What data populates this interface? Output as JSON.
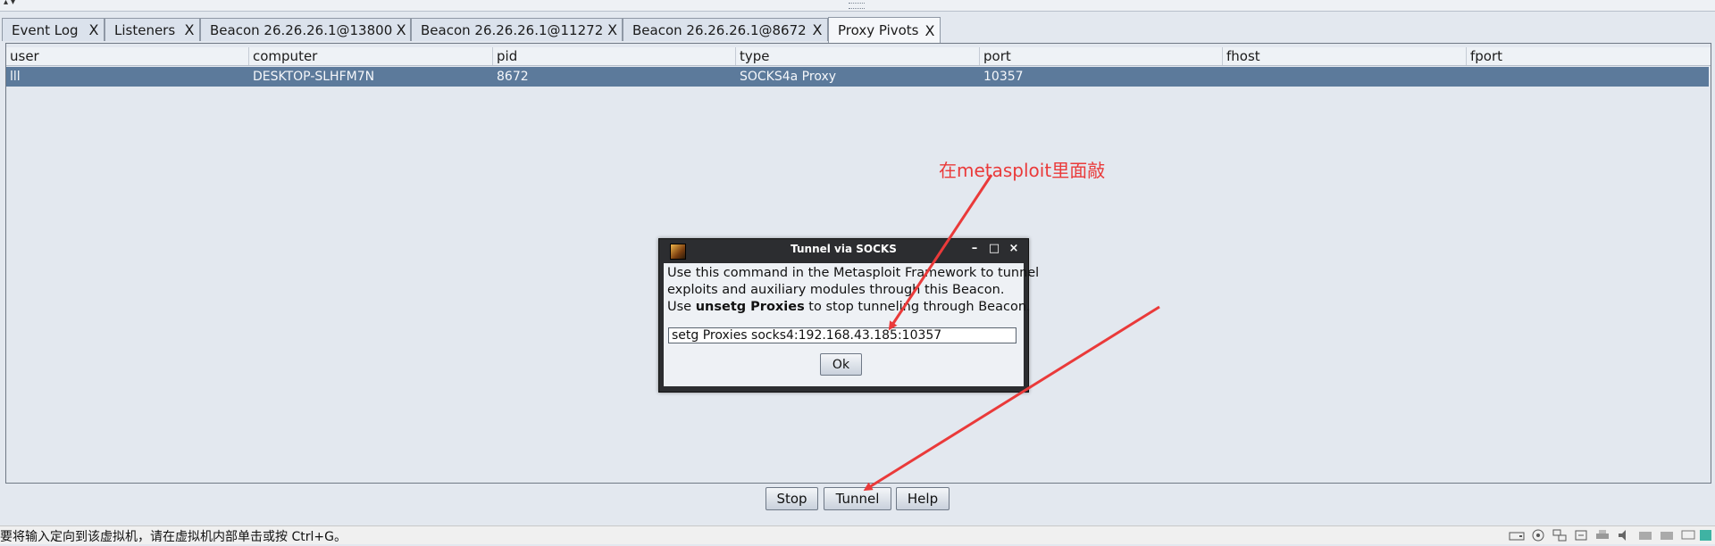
{
  "tabs": [
    {
      "label": "Event Log",
      "close": "X"
    },
    {
      "label": "Listeners",
      "close": "X"
    },
    {
      "label": "Beacon 26.26.26.1@13800",
      "close": "X"
    },
    {
      "label": "Beacon 26.26.26.1@11272",
      "close": "X"
    },
    {
      "label": "Beacon 26.26.26.1@8672",
      "close": "X"
    },
    {
      "label": "Proxy Pivots",
      "close": "X",
      "active": true
    }
  ],
  "table": {
    "columns": [
      "user",
      "computer",
      "pid",
      "type",
      "port",
      "fhost",
      "fport"
    ],
    "rows": [
      [
        "lll",
        "DESKTOP-SLHFM7N",
        "8672",
        "SOCKS4a Proxy",
        "10357",
        "",
        ""
      ]
    ]
  },
  "annotation": {
    "text": "在metasploit里面敲",
    "color": "#ea3a3a"
  },
  "dialog": {
    "title": "Tunnel via SOCKS",
    "line1": "Use this command in the Metasploit Framework to tunnel",
    "line2": "exploits and auxiliary modules through this Beacon.",
    "line3_prefix": "Use ",
    "line3_bold": "unsetg Proxies",
    "line3_suffix": " to stop tunneling through Beacon.",
    "command": "setg Proxies socks4:192.168.43.185:10357",
    "ok_label": "Ok",
    "minimize": "–",
    "maximize": "□",
    "close": "×"
  },
  "buttons": {
    "stop": "Stop",
    "tunnel": "Tunnel",
    "help": "Help"
  },
  "statusbar": {
    "text": "要将输入定向到该虚拟机，请在虚拟机内部单击或按 Ctrl+G。",
    "tray_icons": [
      "hdd-icon",
      "cdrom-icon",
      "network-icon",
      "usb-icon",
      "printer-icon",
      "speaker-icon",
      "device-icon",
      "device-icon",
      "display-icon",
      "notes-icon"
    ]
  },
  "colors": {
    "selection": "#5c7a9b",
    "annotation": "#ea3a3a",
    "background": "#e3e8ef"
  }
}
